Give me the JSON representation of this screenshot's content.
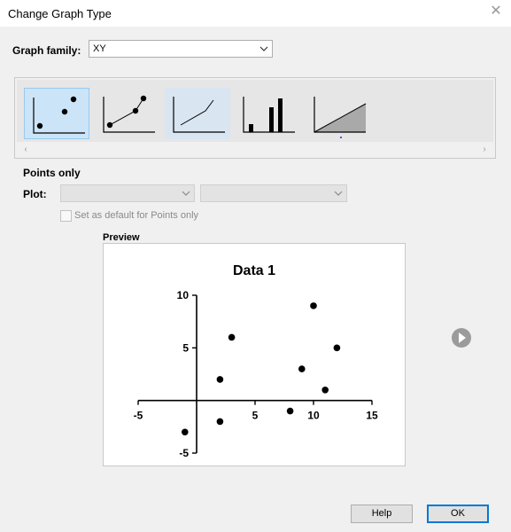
{
  "window": {
    "title": "Change Graph Type"
  },
  "graph_family": {
    "label": "Graph family:",
    "value": "XY"
  },
  "gallery": {
    "tiles": [
      {
        "name": "points-only",
        "state": "selected"
      },
      {
        "name": "points-connected",
        "state": "normal"
      },
      {
        "name": "line-only",
        "state": "hover"
      },
      {
        "name": "spikes",
        "state": "normal"
      },
      {
        "name": "area-fill",
        "state": "normal"
      }
    ],
    "scroll_left": "‹",
    "scroll_right": "›"
  },
  "section": {
    "title": "Points only"
  },
  "plot": {
    "label": "Plot:"
  },
  "default_checkbox": {
    "label": "Set as default for Points only",
    "checked": false
  },
  "preview": {
    "label": "Preview"
  },
  "chart_data": {
    "type": "scatter",
    "title": "Data 1",
    "xlim": [
      -5,
      15
    ],
    "ylim": [
      -5,
      10
    ],
    "xticks": [
      -5,
      5,
      10,
      15
    ],
    "yticks": [
      10,
      5,
      -5
    ],
    "points": [
      {
        "x": -1,
        "y": -3
      },
      {
        "x": 2,
        "y": 2
      },
      {
        "x": 2,
        "y": -2
      },
      {
        "x": 3,
        "y": 6
      },
      {
        "x": 8,
        "y": -1
      },
      {
        "x": 9,
        "y": 3
      },
      {
        "x": 10,
        "y": 9
      },
      {
        "x": 11,
        "y": 1
      },
      {
        "x": 12,
        "y": 5
      }
    ]
  },
  "buttons": {
    "help": "Help",
    "ok": "OK"
  },
  "colors": {
    "selected_bg": "#cce4f7",
    "accent": "#0078d7"
  }
}
